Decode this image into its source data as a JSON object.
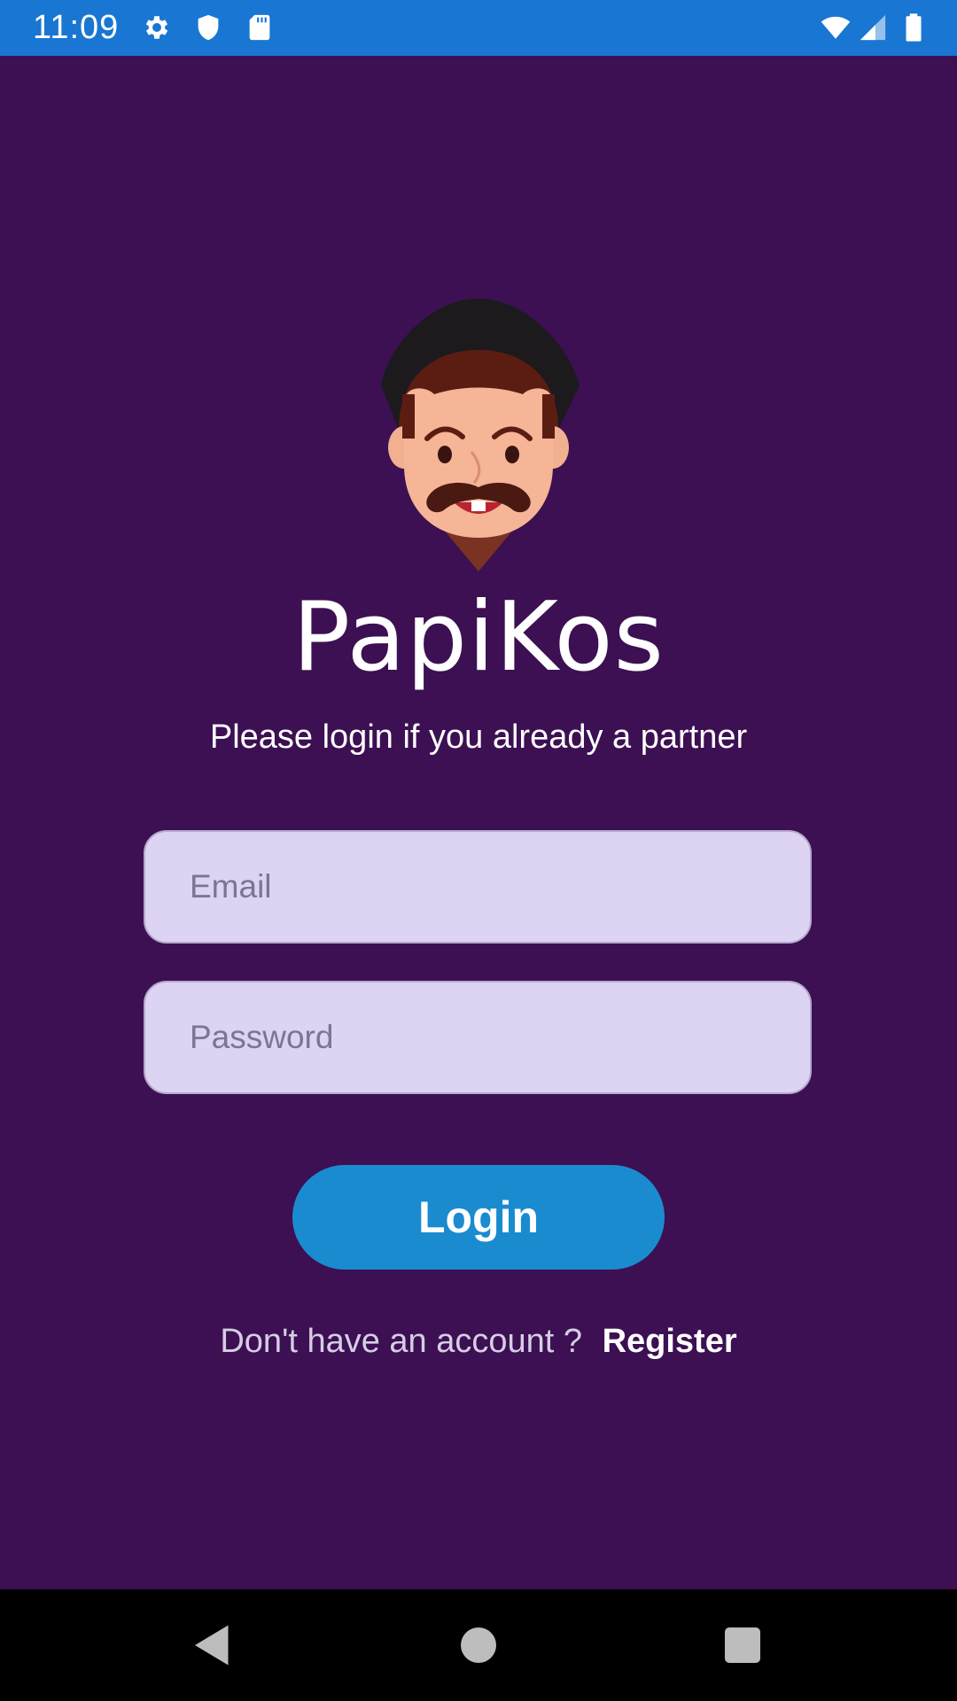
{
  "status_bar": {
    "time": "11:09",
    "icons": [
      "gear-icon",
      "shield-icon",
      "sd-card-icon",
      "wifi-icon",
      "signal-icon",
      "battery-icon"
    ],
    "background_color": "#1976d2"
  },
  "app": {
    "name": "PapiKos",
    "subtitle": "Please login if you already a partner",
    "background_color": "#3c1052"
  },
  "form": {
    "email_placeholder": "Email",
    "password_placeholder": "Password",
    "login_label": "Login",
    "login_color": "#1b8bd0"
  },
  "register": {
    "prompt": "Don't have an account ?",
    "link_label": "Register"
  },
  "nav_bar": {
    "icons": [
      "back-icon",
      "home-icon",
      "recents-icon"
    ]
  }
}
